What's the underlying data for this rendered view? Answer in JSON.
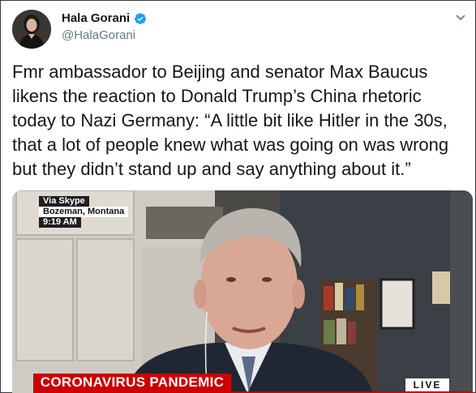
{
  "author": {
    "name": "Hala Gorani",
    "handle": "@HalaGorani",
    "verified": true
  },
  "icons": {
    "verified": "verified-badge-icon",
    "menu": "chevron-down-icon"
  },
  "tweet": {
    "lines": [
      "Fmr ambassador to Beijing and senator Max Baucus",
      "likens the reaction to Donald Trump’s China rhetoric",
      "today to Nazi Germany: “A little bit like Hitler in the 30s,",
      "that a lot of people knew what was going on was wrong",
      "but they didn’t stand up and say anything about it.”"
    ]
  },
  "video": {
    "lower_third": [
      "Via Skype",
      "Bozeman, Montana",
      "9:19 AM"
    ],
    "banner": "CORONAVIRUS PANDEMIC",
    "live": "LIVE"
  },
  "colors": {
    "accent": "#1da1f2",
    "handle": "#657786",
    "banner": "#cc0000"
  }
}
